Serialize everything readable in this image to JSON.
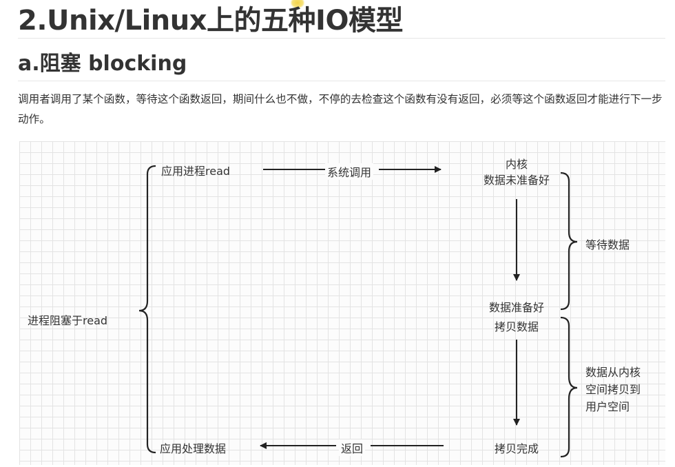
{
  "heading": "2.Unix/Linux上的五种IO模型",
  "subheading": "a.阻塞 blocking",
  "description": "调用者调用了某个函数，等待这个函数返回，期间什么也不做，不停的去检查这个函数有没有返回，必须等这个函数返回才能进行下一步动作。",
  "diagram": {
    "app_read": "应用进程read",
    "syscall": "系统调用",
    "kernel": "内核",
    "data_not_ready": "数据未准备好",
    "wait_data": "等待数据",
    "data_ready": "数据准备好",
    "copy_data": "拷贝数据",
    "copy_desc": [
      "数据从内核",
      "空间拷贝到",
      "用户空间"
    ],
    "blocked": "进程阻塞于read",
    "app_process": "应用处理数据",
    "return": "返回",
    "copy_done": "拷贝完成"
  }
}
